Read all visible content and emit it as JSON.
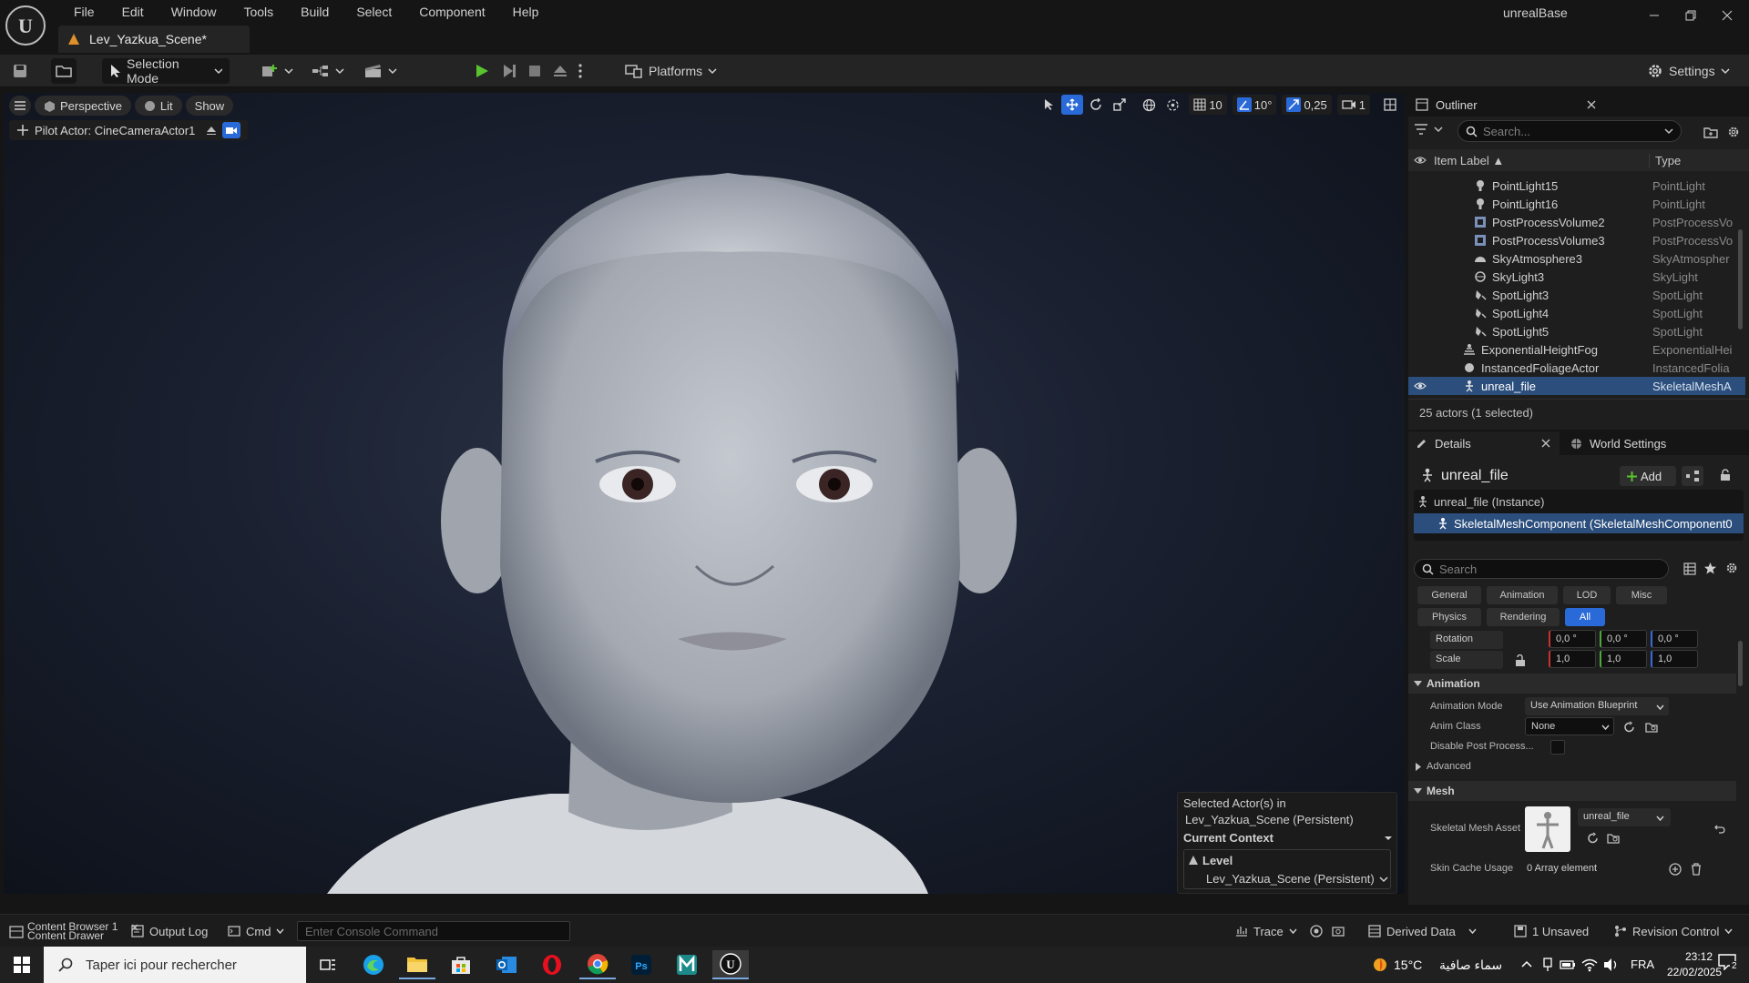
{
  "app": {
    "title": "unrealBase",
    "document_tab": "Lev_Yazkua_Scene*"
  },
  "menu": [
    "File",
    "Edit",
    "Window",
    "Tools",
    "Build",
    "Select",
    "Component",
    "Help"
  ],
  "toolbar": {
    "selection_mode": "Selection Mode",
    "platforms": "Platforms",
    "settings": "Settings"
  },
  "viewport": {
    "view_mode": "Perspective",
    "lighting": "Lit",
    "show": "Show",
    "pilot_actor": "Pilot Actor: CineCameraActor1",
    "grid_size": "10",
    "rotation_snap": "10°",
    "scale_snap": "0,25",
    "camera_speed": "1"
  },
  "context": {
    "selected_line1": "Selected Actor(s) in",
    "selected_line2": "Lev_Yazkua_Scene (Persistent)",
    "current_context": "Current Context",
    "level_label": "Level",
    "level_value": "Lev_Yazkua_Scene (Persistent)"
  },
  "outliner": {
    "tab": "Outliner",
    "search_placeholder": "Search...",
    "col_label": "Item Label ▲",
    "col_type": "Type",
    "rows": [
      {
        "label": "PointLight15",
        "type": "PointLight"
      },
      {
        "label": "PointLight16",
        "type": "PointLight"
      },
      {
        "label": "PostProcessVolume2",
        "type": "PostProcessVo"
      },
      {
        "label": "PostProcessVolume3",
        "type": "PostProcessVo"
      },
      {
        "label": "SkyAtmosphere3",
        "type": "SkyAtmospher"
      },
      {
        "label": "SkyLight3",
        "type": "SkyLight"
      },
      {
        "label": "SpotLight3",
        "type": "SpotLight"
      },
      {
        "label": "SpotLight4",
        "type": "SpotLight"
      },
      {
        "label": "SpotLight5",
        "type": "SpotLight"
      },
      {
        "label": "ExponentialHeightFog",
        "type": "ExponentialHei"
      },
      {
        "label": "InstancedFoliageActor",
        "type": "InstancedFolia"
      },
      {
        "label": "unreal_file",
        "type": "SkeletalMeshA"
      }
    ],
    "footer": "25 actors (1 selected)"
  },
  "details": {
    "tab": "Details",
    "tab2": "World Settings",
    "actor_name": "unreal_file",
    "add_label": "Add",
    "instance": "unreal_file (Instance)",
    "component": "SkeletalMeshComponent (SkeletalMeshComponent0",
    "search_placeholder": "Search",
    "filters": [
      "General",
      "Animation",
      "LOD",
      "Misc",
      "Physics",
      "Rendering",
      "All"
    ],
    "rotation_label": "Rotation",
    "rotation": [
      "0,0 °",
      "0,0 °",
      "0,0 °"
    ],
    "scale_label": "Scale",
    "scale": [
      "1,0",
      "1,0",
      "1,0"
    ],
    "animation_category": "Animation",
    "animation_mode_label": "Animation Mode",
    "animation_mode_value": "Use Animation Blueprint",
    "anim_class_label": "Anim Class",
    "anim_class_value": "None",
    "disable_post_label": "Disable Post Process...",
    "advanced_label": "Advanced",
    "mesh_category": "Mesh",
    "skeletal_mesh_label": "Skeletal Mesh Asset",
    "skeletal_mesh_value": "unreal_file",
    "skin_cache_label": "Skin Cache Usage",
    "skin_cache_value": "0 Array element"
  },
  "statusbar": {
    "content_browser": "Content Browser 1",
    "content_drawer": "Content Drawer",
    "output_log": "Output Log",
    "cmd": "Cmd",
    "console_placeholder": "Enter Console Command",
    "trace": "Trace",
    "derived_data": "Derived Data",
    "unsaved": "1 Unsaved",
    "revision_control": "Revision Control"
  },
  "taskbar": {
    "search_placeholder": "Taper ici pour rechercher",
    "temperature": "15°C",
    "weather": "سماء صافية",
    "language": "FRA",
    "time": "23:12",
    "date": "22/02/2025",
    "notifications": "2"
  },
  "colors": {
    "accent": "#2a6ad8",
    "selection": "#2b4e7c",
    "play": "#5ac22e",
    "panel": "#1e1e1e"
  }
}
